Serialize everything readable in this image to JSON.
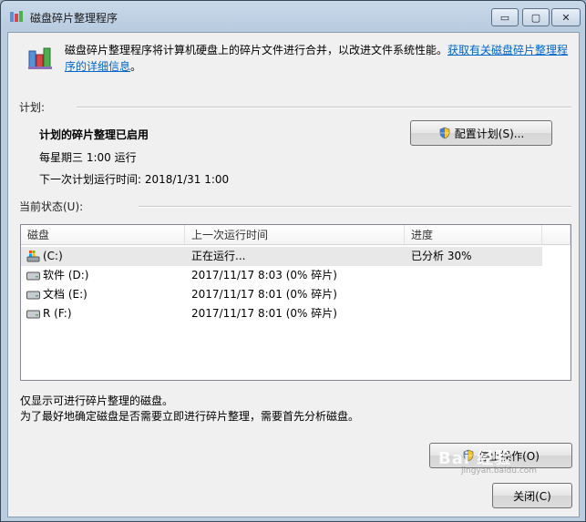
{
  "window": {
    "title": "磁盘碎片整理程序",
    "min_glyph": "▭",
    "max_glyph": "▢",
    "close_glyph": "✕"
  },
  "header": {
    "description": "磁盘碎片整理程序将计算机硬盘上的碎片文件进行合并，以改进文件系统性能。",
    "link": "获取有关磁盘碎片整理程序的详细信息",
    "link_suffix": "。"
  },
  "schedule": {
    "section_label": "计划:",
    "status": "计划的碎片整理已启用",
    "frequency": "每星期三  1:00 运行",
    "next_run": "下一次计划运行时间: 2018/1/31 1:00",
    "configure_button": "配置计划(S)..."
  },
  "current_status": {
    "section_label": "当前状态(U):",
    "columns": [
      "磁盘",
      "上一次运行时间",
      "进度"
    ],
    "rows": [
      {
        "disk": "(C:)",
        "last_run": "正在运行...",
        "progress": "已分析 30%",
        "icon": "system-drive-icon"
      },
      {
        "disk": "软件 (D:)",
        "last_run": "2017/11/17 8:03 (0% 碎片)",
        "progress": "",
        "icon": "drive-icon"
      },
      {
        "disk": "文档 (E:)",
        "last_run": "2017/11/17 8:01 (0% 碎片)",
        "progress": "",
        "icon": "drive-icon"
      },
      {
        "disk": "R  (F:)",
        "last_run": "2017/11/17 8:01 (0% 碎片)",
        "progress": "",
        "icon": "drive-icon"
      }
    ]
  },
  "footer": {
    "note1": "仅显示可进行碎片整理的磁盘。",
    "note2": "为了最好地确定磁盘是否需要立即进行碎片整理，需要首先分析磁盘。",
    "stop_button": "停止操作(O)",
    "close_button": "关闭(C)"
  },
  "watermark": {
    "text": "Bai 经验",
    "sub": "jingyan.baidu.com"
  }
}
